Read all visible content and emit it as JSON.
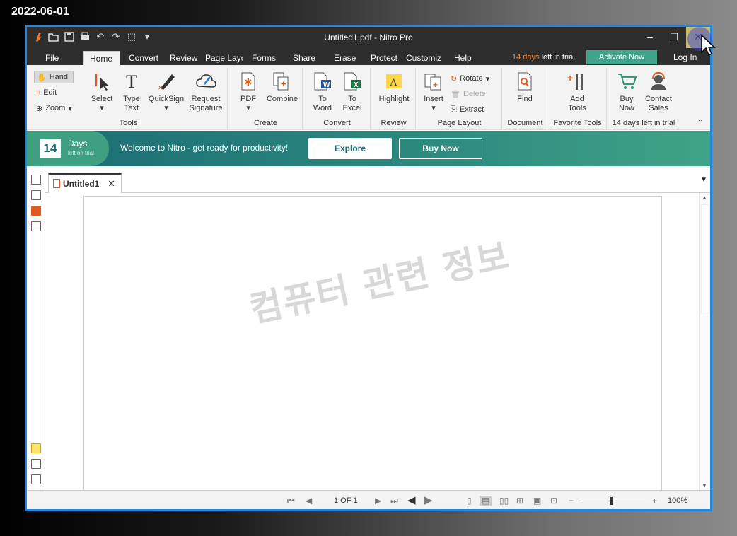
{
  "screenshot_date": "2022-06-01",
  "window": {
    "title": "Untitled1.pdf - Nitro Pro",
    "minimize_glyph": "‒",
    "maximize_glyph": "☐",
    "close_glyph": "✕"
  },
  "menu_tabs": [
    {
      "label": "File"
    },
    {
      "label": "Home"
    },
    {
      "label": "Convert"
    },
    {
      "label": "Review"
    },
    {
      "label": "Page Layc"
    },
    {
      "label": "Forms"
    },
    {
      "label": "Share"
    },
    {
      "label": "Erase"
    },
    {
      "label": "Protect"
    },
    {
      "label": "Customiz"
    },
    {
      "label": "Help"
    }
  ],
  "trial": {
    "days": "14 days",
    "rest": " left in trial"
  },
  "activate_label": "Activate Now",
  "login_label": "Log In",
  "ribbon": {
    "tools": {
      "hand": "Hand",
      "edit": "Edit",
      "zoom": "Zoom",
      "select": "Select",
      "type_text_1": "Type",
      "type_text_2": "Text",
      "quicksign": "QuickSign",
      "request_1": "Request",
      "request_2": "Signature",
      "label": "Tools"
    },
    "create": {
      "pdf": "PDF",
      "combine": "Combine",
      "label": "Create"
    },
    "convert": {
      "to_word_1": "To",
      "to_word_2": "Word",
      "to_excel_1": "To",
      "to_excel_2": "Excel",
      "label": "Convert"
    },
    "review": {
      "highlight": "Highlight",
      "label": "Review"
    },
    "page_layout": {
      "insert": "Insert",
      "rotate": "Rotate",
      "delete": "Delete",
      "extract": "Extract",
      "label": "Page Layout"
    },
    "document": {
      "find": "Find",
      "label": "Document"
    },
    "favorite": {
      "add_1": "Add",
      "add_2": "Tools",
      "label": "Favorite Tools"
    },
    "trial": {
      "buy_1": "Buy",
      "buy_2": "Now",
      "contact_1": "Contact",
      "contact_2": "Sales",
      "label": "14 days left in trial"
    }
  },
  "banner": {
    "days_number": "14",
    "days_label": "Days",
    "days_sub": "left on trial",
    "welcome": "Welcome to Nitro - get ready for productivity!",
    "explore": "Explore",
    "buy_now": "Buy Now"
  },
  "document": {
    "tab_name": "Untitled1",
    "watermark": "컴퓨터 관련 정보"
  },
  "status": {
    "page_indicator": "1 OF 1",
    "zoom": "100%",
    "zoom_fraction": 0.45
  }
}
